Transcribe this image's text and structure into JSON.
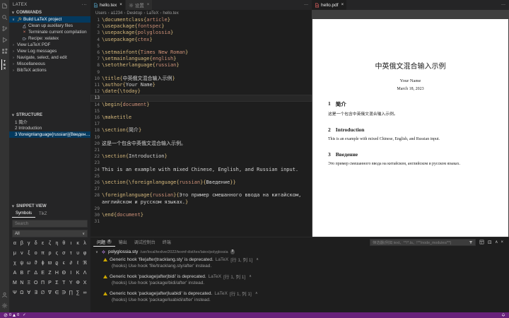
{
  "icons": {
    "more": "···",
    "chevron_down": "∨",
    "chevron_right": "›",
    "chevron_up": "∧",
    "close": "×",
    "check": "✓",
    "breadcrumb_sep": "›"
  },
  "activity_bar": {
    "latex_label": "TEX"
  },
  "sidebar": {
    "title": "LATEX",
    "commands": {
      "header": "COMMANDS",
      "items": [
        {
          "name": "build-latex-project",
          "label": "Build LaTeX project",
          "icon": "build",
          "chevron": "down",
          "indent": 0,
          "selected": true
        },
        {
          "name": "clean-auxiliary-files",
          "label": "Clean up auxiliary files",
          "icon": "clean",
          "indent": 1
        },
        {
          "name": "terminate-compilation",
          "label": "Terminate current compilation",
          "icon": "terminate",
          "indent": 1
        },
        {
          "name": "recipe-xelatex",
          "label": "Recipe: xelatex",
          "icon": "recipe",
          "indent": 1
        },
        {
          "name": "view-latex-pdf",
          "label": "View LaTeX PDF",
          "chevron": "right",
          "indent": 0
        },
        {
          "name": "view-log-messages",
          "label": "View Log messages",
          "chevron": "right",
          "indent": 0
        },
        {
          "name": "navigate-select-edit",
          "label": "Navigate, select, and edit",
          "chevron": "right",
          "indent": 0
        },
        {
          "name": "miscellaneous",
          "label": "Miscellaneous",
          "chevron": "right",
          "indent": 0
        },
        {
          "name": "bibtex-actions",
          "label": "BibTeX actions",
          "chevron": "right",
          "indent": 0
        }
      ]
    },
    "structure": {
      "header": "STRUCTURE",
      "items": [
        {
          "name": "structure-item-1",
          "label": "1 简介"
        },
        {
          "name": "structure-item-2",
          "label": "2 Introduction"
        },
        {
          "name": "structure-item-3",
          "label": "3 \\foreignlanguage{russian}{Введение}",
          "selected": true
        }
      ]
    },
    "snippet": {
      "header": "SNIPPET VIEW",
      "tabs": [
        {
          "name": "symbols",
          "label": "Symbols",
          "active": true
        },
        {
          "name": "tikz",
          "label": "TikZ"
        }
      ],
      "search_placeholder": "Search",
      "filter_value": "All",
      "symbol_rows": [
        [
          "α",
          "β",
          "γ",
          "δ",
          "ε",
          "ζ",
          "η",
          "θ",
          "ι",
          "κ",
          "λ"
        ],
        [
          "μ",
          "ν",
          "ξ",
          "ο",
          "π",
          "ρ",
          "ς",
          "σ",
          "τ",
          "υ",
          "φ"
        ],
        [
          "χ",
          "ψ",
          "ω",
          "ϑ",
          "ϕ",
          "ϖ",
          "ϱ",
          "ϵ",
          "∂",
          "ℓ",
          "ℜ"
        ],
        [
          "Α",
          "Β",
          "Γ",
          "Δ",
          "Ε",
          "Ζ",
          "Η",
          "Θ",
          "Ι",
          "Κ",
          "Λ"
        ],
        [
          "Μ",
          "Ν",
          "Ξ",
          "Ο",
          "Π",
          "Ρ",
          "Σ",
          "Τ",
          "Υ",
          "Φ",
          "Χ"
        ],
        [
          "Ψ",
          "Ω",
          "∀",
          "∃",
          "∅",
          "∇",
          "∈",
          "∋",
          "∏",
          "∑",
          "∞"
        ]
      ]
    }
  },
  "editor": {
    "tabs": [
      {
        "name": "hello-tex",
        "label": "hello.tex",
        "icon": "tex",
        "active": true
      },
      {
        "name": "settings",
        "label": "设置",
        "icon": "gear"
      }
    ],
    "breadcrumb": [
      "Users",
      "a1234",
      "Desktop",
      "LaTeX",
      "hello.tex"
    ],
    "current_line": 13,
    "lines": [
      [
        [
          "cmd",
          "\\documentclass"
        ],
        [
          "pun",
          "{"
        ],
        [
          "arg",
          "article"
        ],
        [
          "pun",
          "}"
        ]
      ],
      [
        [
          "cmd",
          "\\usepackage"
        ],
        [
          "pun",
          "{"
        ],
        [
          "arg",
          "fontspec"
        ],
        [
          "pun",
          "}"
        ]
      ],
      [
        [
          "cmd",
          "\\usepackage"
        ],
        [
          "pun",
          "{"
        ],
        [
          "arg",
          "polyglossia"
        ],
        [
          "pun",
          "}"
        ]
      ],
      [
        [
          "cmd",
          "\\usepackage"
        ],
        [
          "pun",
          "{"
        ],
        [
          "arg",
          "ctex"
        ],
        [
          "pun",
          "}"
        ]
      ],
      [],
      [
        [
          "cmd",
          "\\setmainfont"
        ],
        [
          "pun",
          "{"
        ],
        [
          "arg",
          "Times New Roman"
        ],
        [
          "pun",
          "}"
        ]
      ],
      [
        [
          "cmd",
          "\\setmainlanguage"
        ],
        [
          "pun",
          "{"
        ],
        [
          "arg",
          "english"
        ],
        [
          "pun",
          "}"
        ]
      ],
      [
        [
          "cmd",
          "\\setotherlanguage"
        ],
        [
          "pun",
          "{"
        ],
        [
          "arg",
          "russian"
        ],
        [
          "pun",
          "}"
        ]
      ],
      [],
      [
        [
          "cmd",
          "\\title"
        ],
        [
          "pun",
          "{"
        ],
        [
          "txt",
          "中英俄文混合输入示例"
        ],
        [
          "pun",
          "}"
        ]
      ],
      [
        [
          "cmd",
          "\\author"
        ],
        [
          "pun",
          "{"
        ],
        [
          "txt",
          "Your Name"
        ],
        [
          "pun",
          "}"
        ]
      ],
      [
        [
          "cmd",
          "\\date"
        ],
        [
          "pun",
          "{"
        ],
        [
          "cmd",
          "\\today"
        ],
        [
          "pun",
          "}"
        ]
      ],
      [],
      [
        [
          "cmd",
          "\\begin"
        ],
        [
          "pun",
          "{"
        ],
        [
          "arg",
          "document"
        ],
        [
          "pun",
          "}"
        ]
      ],
      [],
      [
        [
          "cmd",
          "\\maketitle"
        ]
      ],
      [],
      [
        [
          "cmd",
          "\\section"
        ],
        [
          "pun",
          "{"
        ],
        [
          "txt",
          "简介"
        ],
        [
          "pun",
          "}"
        ]
      ],
      [],
      [
        [
          "txt",
          "这是一个包含中英俄文混合输入示例。"
        ]
      ],
      [],
      [
        [
          "cmd",
          "\\section"
        ],
        [
          "pun",
          "{"
        ],
        [
          "txt",
          "Introduction"
        ],
        [
          "pun",
          "}"
        ]
      ],
      [],
      [
        [
          "txt",
          "This is an example with mixed Chinese, English, and Russian input."
        ]
      ],
      [],
      [
        [
          "cmd",
          "\\section"
        ],
        [
          "pun",
          "{"
        ],
        [
          "cmd",
          "\\foreignlanguage"
        ],
        [
          "pun",
          "{"
        ],
        [
          "arg",
          "russian"
        ],
        [
          "pun",
          "}{"
        ],
        [
          "txt",
          "Введение"
        ],
        [
          "pun",
          "}}"
        ]
      ],
      [],
      [
        [
          "cmd",
          "\\foreignlanguage"
        ],
        [
          "pun",
          "{"
        ],
        [
          "arg",
          "russian"
        ],
        [
          "pun",
          "}{"
        ],
        [
          "txt",
          "Это пример смешанного ввода на китайском, английском и русском языках."
        ],
        [
          "pun",
          "}"
        ]
      ],
      [],
      [
        [
          "cmd",
          "\\end"
        ],
        [
          "pun",
          "{"
        ],
        [
          "arg",
          "document"
        ],
        [
          "pun",
          "}"
        ]
      ],
      []
    ]
  },
  "pdf": {
    "tab": "hello.pdf",
    "title": "中英俄文混合输入示例",
    "author": "Your Name",
    "date": "March 18, 2023",
    "sections": [
      {
        "number": "1",
        "heading": "简介",
        "body": "这是一个包含中英俄文混合输入示例。"
      },
      {
        "number": "2",
        "heading": "Introduction",
        "body": "This is an example with mixed Chinese, English, and Russian input."
      },
      {
        "number": "3",
        "heading": "Введение",
        "body": "Это пример смешанного ввода на китайском, английском и русском языках."
      }
    ]
  },
  "panel": {
    "tabs": [
      {
        "name": "problems",
        "label": "问题",
        "badge": "4",
        "active": true
      },
      {
        "name": "output",
        "label": "输出"
      },
      {
        "name": "debug-console",
        "label": "调试控制台"
      },
      {
        "name": "terminal",
        "label": "终端"
      }
    ],
    "filter_placeholder": "筛选器(例如 text、**/*.ts、!**/node_modules/**)",
    "file": {
      "name": "polyglossia.sty",
      "path": "/usr/local/texlive/2022/texmf-dist/tex/latex/polyglossia",
      "badge": "3"
    },
    "problems": [
      {
        "message": "Generic hook 'file|after|tracklang.sty' is deprecated.",
        "source": "LaTeX",
        "position": "[行 1, 列 1]",
        "detail": "(hooks) Use hook 'file/tracklang.sty/after' instead."
      },
      {
        "message": "Generic hook 'package|after|bidi' is deprecated.",
        "source": "LaTeX",
        "position": "[行 1, 列 1]",
        "detail": "(hooks) Use hook 'package/bidi/after' instead."
      },
      {
        "message": "Generic hook 'package|after|luabidi' is deprecated.",
        "source": "LaTeX",
        "position": "[行 1, 列 1]",
        "detail": "(hooks) Use hook 'package/luabidi/after' instead."
      }
    ]
  },
  "status_bar": {
    "errors": "0",
    "warnings": "0",
    "check": "✓"
  },
  "colors": {
    "status_bar": "#68217a",
    "selection": "#04395e",
    "warning": "#cca700",
    "editor_bg": "#1e1e1e",
    "sidebar_bg": "#252526",
    "activity_bar_bg": "#333333"
  }
}
